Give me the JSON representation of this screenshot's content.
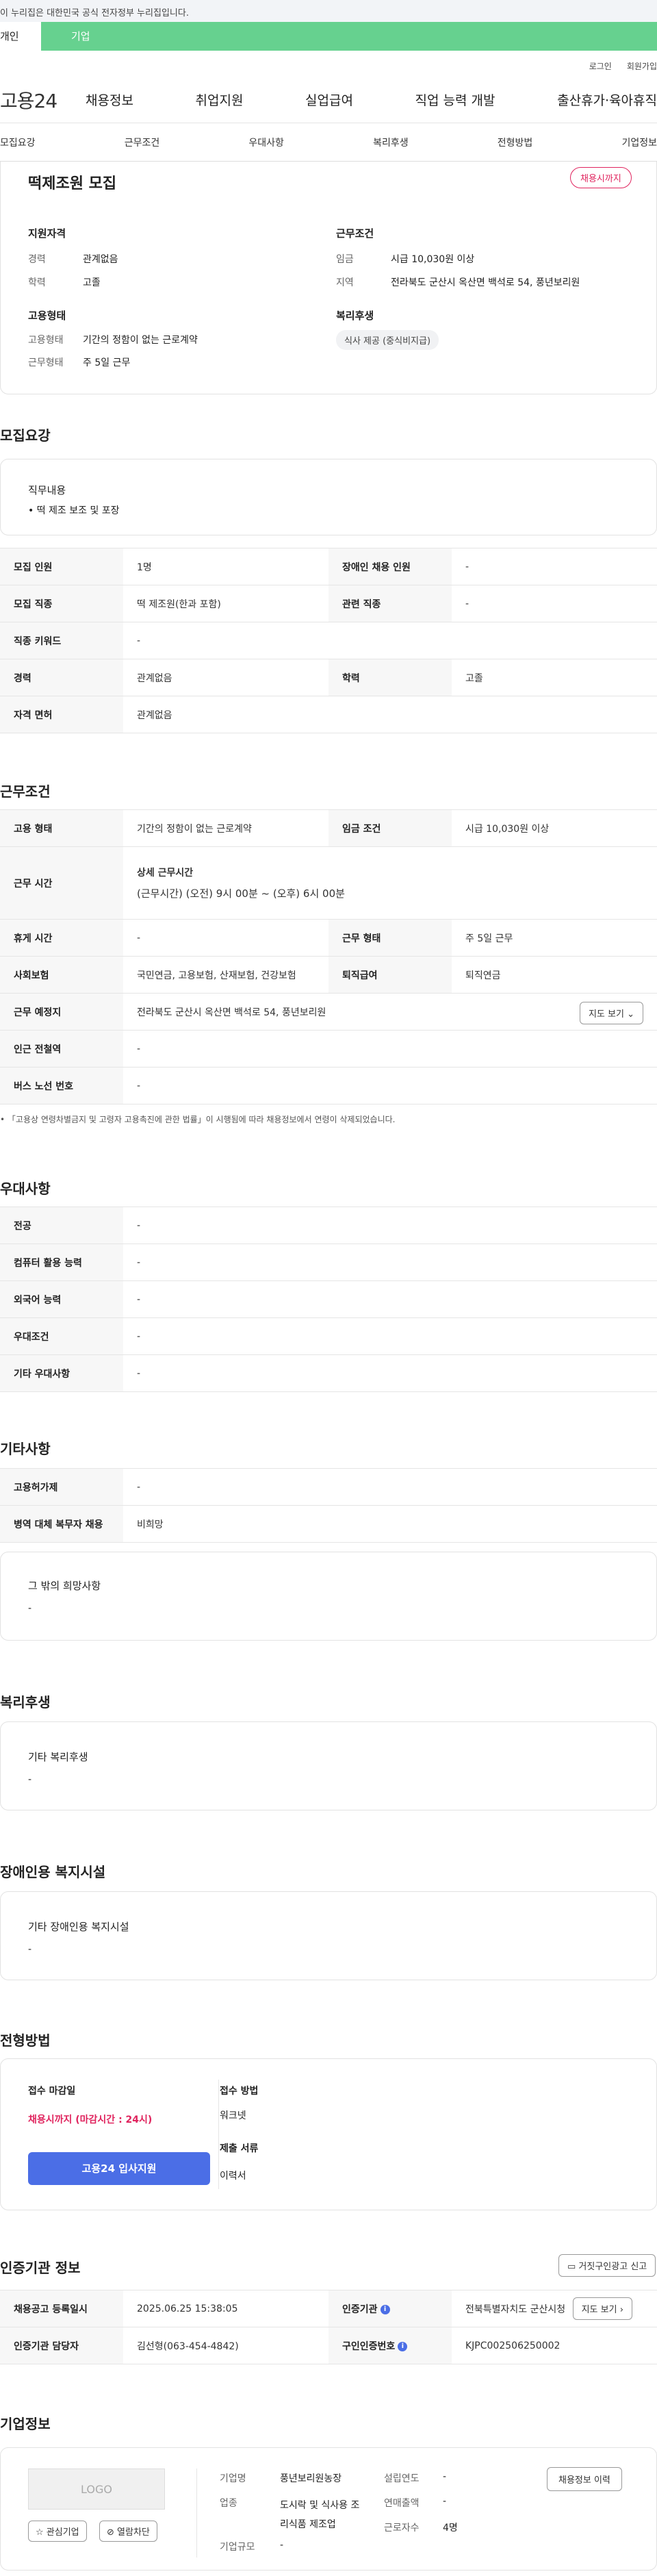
{
  "gov_banner": "이 누리집은 대한민국 공식 전자정부 누리집입니다.",
  "tabs": {
    "t1": "개인",
    "t2": "기업"
  },
  "util": {
    "login": "로그인",
    "join": "회원가입"
  },
  "logo": "고용24",
  "gnb": [
    "채용정보",
    "취업지원",
    "실업급여",
    "직업 능력 개발",
    "출산휴가·육아휴직"
  ],
  "anchors": [
    "모집요강",
    "근무조건",
    "우대사항",
    "복리후생",
    "전형방법",
    "기업정보"
  ],
  "summary": {
    "title": "떡제조원 모집",
    "badge": "채용시까지",
    "qual_head": "지원자격",
    "career_l": "경력",
    "career_v": "관계없음",
    "edu_l": "학력",
    "edu_v": "고졸",
    "emp_head": "고용형태",
    "emptype_l": "고용형태",
    "emptype_v": "기간의 정함이 없는 근로계약",
    "worktype_l": "근무형태",
    "worktype_v": "주 5일 근무",
    "cond_head": "근무조건",
    "wage_l": "임금",
    "wage_v": "시급 10,030원 이상",
    "area_l": "지역",
    "area_v": "전라북도 군산시 옥산면 백석로 54, 풍년보리원",
    "welfare_head": "복리후생",
    "welfare_chip": "식사 제공 (중식비지급)"
  },
  "recruit": {
    "title": "모집요강",
    "duty_head": "직무내용",
    "duty_text": "• 떡 제조 보조 및 포장",
    "rows": [
      [
        "모집 인원",
        "1명",
        "장애인 채용 인원",
        "-"
      ],
      [
        "모집 직종",
        "떡 제조원(한과 포함)",
        "관련 직종",
        "-"
      ],
      [
        "직종 키워드",
        "-"
      ],
      [
        "경력",
        "관계없음",
        "학력",
        "고졸"
      ],
      [
        "자격 면허",
        "관계없음"
      ]
    ]
  },
  "work": {
    "title": "근무조건",
    "emp_l": "고용 형태",
    "emp_v": "기간의 정함이 없는 근로계약",
    "wage_l": "임금 조건",
    "wage_v": "시급 10,030원 이상",
    "time_l": "근무 시간",
    "time_sub": "상세 근무시간",
    "time_v": "(근무시간) (오전) 9시 00분 ~ (오후) 6시 00분",
    "rest_l": "휴게 시간",
    "rest_v": "-",
    "form_l": "근무 형태",
    "form_v": "주 5일 근무",
    "ins_l": "사회보험",
    "ins_v": "국민연금, 고용보험, 산재보험, 건강보험",
    "ret_l": "퇴직급여",
    "ret_v": "퇴직연금",
    "place_l": "근무 예정지",
    "place_v": "전라북도 군산시 옥산면 백석로 54, 풍년보리원",
    "map_btn": "지도 보기",
    "station_l": "인근 전철역",
    "station_v": "-",
    "bus_l": "버스 노선 번호",
    "bus_v": "-",
    "note": "「고용상 연령차별금지 및 고령자 고용촉진에 관한 법률」이 시행됨에 따라 채용정보에서 연령이 삭제되었습니다."
  },
  "pref": {
    "title": "우대사항",
    "rows": [
      [
        "전공",
        "-"
      ],
      [
        "컴퓨터 활용 능력",
        "-"
      ],
      [
        "외국어 능력",
        "-"
      ],
      [
        "우대조건",
        "-"
      ],
      [
        "기타 우대사항",
        "-"
      ]
    ]
  },
  "etc": {
    "title": "기타사항",
    "rows": [
      [
        "고용허가제",
        "-"
      ],
      [
        "병역 대체 복무자 채용",
        "비희망"
      ]
    ],
    "box_head": "그 밖의 희망사항",
    "box_val": "-"
  },
  "welfare": {
    "title": "복리후생",
    "box_head": "기타 복리후생",
    "box_val": "-"
  },
  "disab": {
    "title": "장애인용 복지시설",
    "box_head": "기타 장애인용 복지시설",
    "box_val": "-"
  },
  "process": {
    "title": "전형방법",
    "deadline_l": "접수 마감일",
    "deadline_v": "채용시까지 (마감시간 : 24시)",
    "apply_btn": "고용24 입사지원",
    "method_l": "접수 방법",
    "method_v": "워크넷",
    "docs_l": "제출 서류",
    "docs_v": "이력서"
  },
  "cert": {
    "title": "인증기관 정보",
    "report_btn": "거짓구인광고 신고",
    "reg_l": "채용공고 등록일시",
    "reg_v": "2025.06.25 15:38:05",
    "org_l": "인증기관",
    "org_v": "전북특별자치도 군산시청",
    "map_btn": "지도 보기",
    "mgr_l": "인증기관 담당자",
    "mgr_v": "김선형(063-454-4842)",
    "num_l": "구인인증번호",
    "num_v": "KJPC002506250002"
  },
  "company": {
    "title": "기업정보",
    "logo": "LOGO",
    "fav_btn": "관심기업",
    "block_btn": "열람차단",
    "name_l": "기업명",
    "name_v": "풍년보리원농장",
    "ind_l": "업종",
    "ind_v": "도시락 및 식사용 조리식품 제조업",
    "size_l": "기업규모",
    "size_v": "-",
    "est_l": "설립연도",
    "est_v": "-",
    "sales_l": "연매출액",
    "sales_v": "-",
    "emp_l": "근로자수",
    "emp_v": "4명",
    "history_btn": "채용정보 이력"
  },
  "colors": {
    "accent_green": "#66d18f",
    "accent_blue": "#4b6ee6",
    "accent_red": "#e0245e"
  }
}
